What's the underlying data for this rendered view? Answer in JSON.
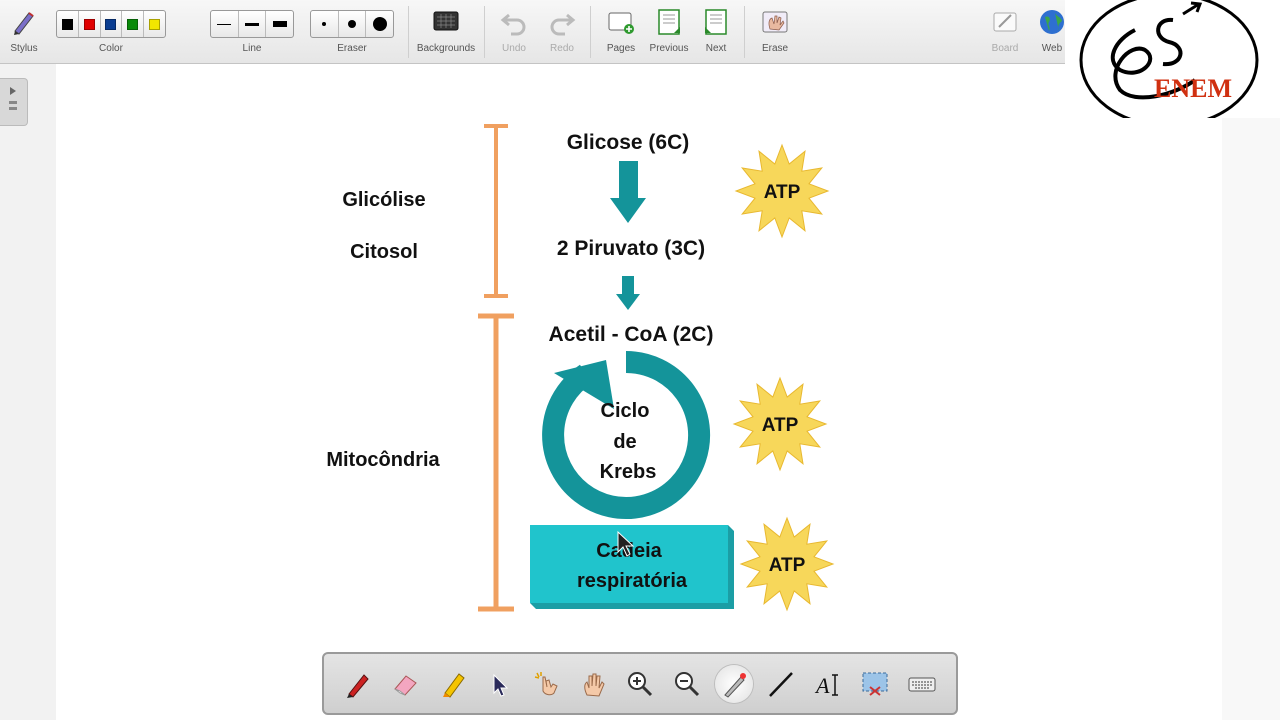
{
  "toolbar": {
    "stylus": "Stylus",
    "color": "Color",
    "line": "Line",
    "eraser": "Eraser",
    "backgrounds": "Backgrounds",
    "undo": "Undo",
    "redo": "Redo",
    "pages": "Pages",
    "previous": "Previous",
    "next": "Next",
    "erase": "Erase",
    "board": "Board",
    "web": "Web",
    "colors": [
      "#000000",
      "#e00000",
      "#0a3d91",
      "#0a8a0a",
      "#f2e600"
    ]
  },
  "diagram": {
    "glicolise": "Glicólise",
    "citosol": "Citosol",
    "mitocondria": "Mitocôndria",
    "glicose": "Glicose (6C)",
    "piruvato": "2 Piruvato (3C)",
    "acetil": "Acetil - CoA (2C)",
    "krebs_line1": "Ciclo",
    "krebs_line2": "de",
    "krebs_line3": "Krebs",
    "cadeia_line1": "Cadeia",
    "cadeia_line2": "respiratória",
    "atp": "ATP",
    "accent_orange": "#f0a060",
    "accent_teal": "#14949a",
    "accent_cyan": "#20c4cc",
    "atp_yellow": "#f7d75a"
  },
  "logo": {
    "text": "ENEM"
  },
  "bottom_toolbar": {
    "tools": [
      "pen-icon",
      "eraser-icon",
      "highlighter-icon",
      "pointer-icon",
      "magic-pointer-icon",
      "hand-icon",
      "zoom-in-icon",
      "zoom-out-icon",
      "laser-pointer-icon",
      "line-icon",
      "text-icon",
      "screen-capture-icon",
      "keyboard-icon"
    ]
  }
}
